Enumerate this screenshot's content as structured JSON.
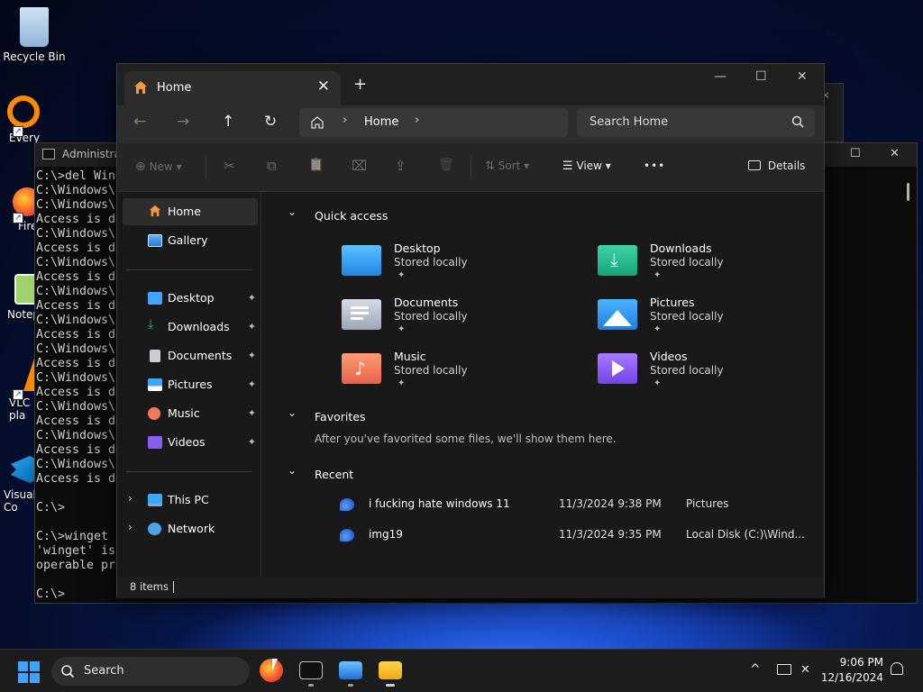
{
  "desktop": {
    "icons": [
      {
        "label": "Recycle Bin"
      },
      {
        "label": "Every"
      },
      {
        "label": "Fire"
      },
      {
        "label": "Notep"
      },
      {
        "label": "VLC r\npla"
      },
      {
        "label": "Visual\nCo"
      }
    ]
  },
  "terminal": {
    "title": "Administrat",
    "lines": [
      "C:\\>del Wind",
      "C:\\Windows\\",
      "C:\\Windows\\",
      "Access is de",
      "C:\\Windows\\",
      "Access is de",
      "C:\\Windows\\",
      "Access is de",
      "C:\\Windows\\",
      "Access is de",
      "C:\\Windows\\",
      "Access is de",
      "C:\\Windows\\",
      "Access is de",
      "C:\\Windows\\",
      "Access is de",
      "C:\\Windows\\",
      "Access is de",
      "C:\\Windows\\",
      "Access is de",
      "C:\\Windows\\",
      "Access is de",
      "",
      "C:\\>",
      "",
      "C:\\>winget s",
      "'winget' is",
      "operable pro",
      "",
      "C:\\>"
    ]
  },
  "explorer": {
    "tab": {
      "label": "Home",
      "close": "✕"
    },
    "new_tab": "+",
    "window_controls": {
      "minimize": "—",
      "maximize": "☐",
      "close": "✕"
    },
    "nav": {
      "back": "←",
      "forward": "→",
      "up": "↑",
      "refresh": "↻"
    },
    "address": {
      "segment": "Home",
      "sep1": "›",
      "sep2": "›"
    },
    "search": {
      "placeholder": "Search Home"
    },
    "toolbar": {
      "new": "New",
      "new_caret": "▾",
      "cut": "✂",
      "copy": "⧉",
      "paste": "📋",
      "rename": "⌧",
      "share": "⇪",
      "delete": "🗑",
      "sort": "Sort",
      "sort_caret": "▾",
      "view": "View",
      "view_caret": "▾",
      "more": "•••",
      "details": "Details"
    },
    "sidebar": {
      "home": "Home",
      "gallery": "Gallery",
      "pinned": [
        {
          "label": "Desktop",
          "color": "#3fa6ff"
        },
        {
          "label": "Downloads",
          "color": "#29b37a"
        },
        {
          "label": "Documents",
          "color": "#c9ced6"
        },
        {
          "label": "Pictures",
          "color": "#3fa6ff"
        },
        {
          "label": "Music",
          "color": "#f07b56"
        },
        {
          "label": "Videos",
          "color": "#8a5cf0"
        }
      ],
      "pin_glyph": "📌",
      "this_pc": "This PC",
      "network": "Network",
      "chev": "›"
    },
    "quick_access": {
      "title": "Quick access",
      "items": [
        {
          "name": "Desktop",
          "sub": "Stored locally",
          "color": "#2f9bff"
        },
        {
          "name": "Downloads",
          "sub": "Stored locally",
          "color": "#1fb58e"
        },
        {
          "name": "Documents",
          "sub": "Stored locally",
          "color": "#aeb8c6"
        },
        {
          "name": "Pictures",
          "sub": "Stored locally",
          "color": "#2f9bff"
        },
        {
          "name": "Music",
          "sub": "Stored locally",
          "color": "#ef7a57"
        },
        {
          "name": "Videos",
          "sub": "Stored locally",
          "color": "#8a57f0"
        }
      ],
      "pin": "📌"
    },
    "favorites": {
      "title": "Favorites",
      "message": "After you've favorited some files, we'll show them here."
    },
    "recent": {
      "title": "Recent",
      "items": [
        {
          "name": "i fucking hate windows 11",
          "date": "11/3/2024 9:38 PM",
          "location": "Pictures"
        },
        {
          "name": "img19",
          "date": "11/3/2024 9:35 PM",
          "location": "Local Disk (C:)\\Wind..."
        }
      ]
    },
    "section_chev": "⌄",
    "status": {
      "count": "8 items"
    }
  },
  "taskbar": {
    "search_label": "Search",
    "tray_chevron": "^",
    "clock": {
      "time": "9:06 PM",
      "date": "12/16/2024"
    },
    "bell": "🔔"
  }
}
